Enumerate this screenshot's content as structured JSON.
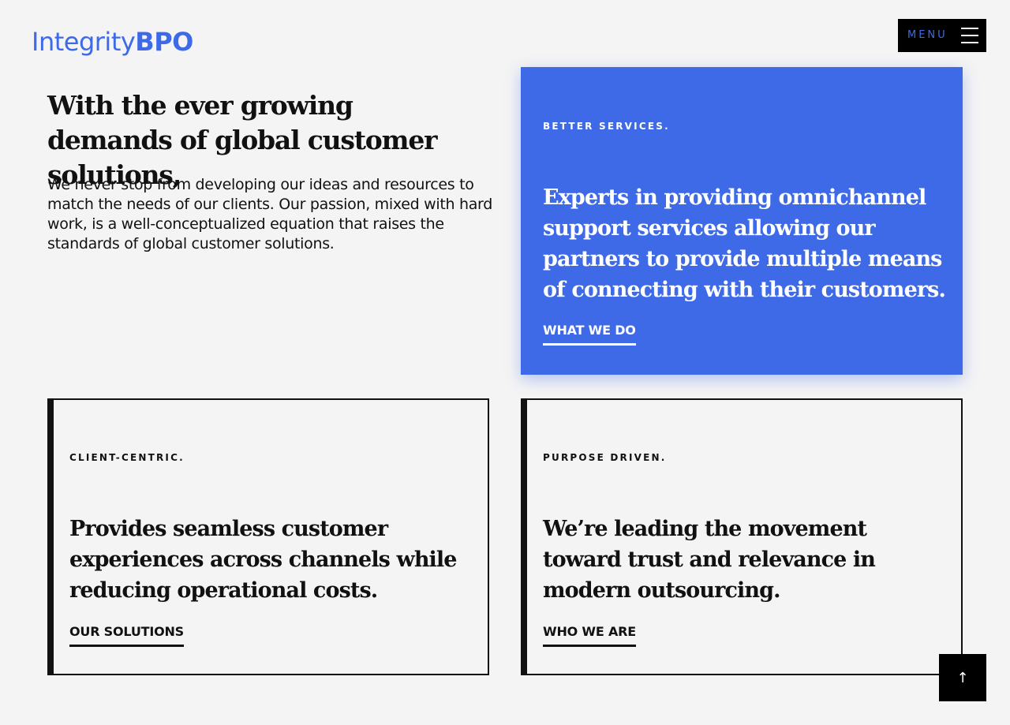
{
  "header": {
    "logo_light": "Integrity",
    "logo_bold": "BPO",
    "menu_label": "MENU",
    "brand_color": "#3e6ae8"
  },
  "intro": {
    "headline": "With the ever growing demands of global customer solutions,",
    "body": "We never stop from developing our ideas and resources to match the needs of our clients. Our passion, mixed with hard work, is a well-conceptualized equation that raises the standards of global customer solutions."
  },
  "cards": [
    {
      "eyebrow": "BETTER SERVICES.",
      "text": "Experts in providing omnichannel support services allowing our partners to provide multiple means of connecting with their customers.",
      "link": "WHAT WE DO"
    },
    {
      "eyebrow": "CLIENT-CENTRIC.",
      "text": "Provides seamless customer experiences across channels while reducing operational costs.",
      "link": "OUR SOLUTIONS"
    },
    {
      "eyebrow": "PURPOSE DRIVEN.",
      "text": "We’re leading the movement toward trust and relevance in modern outsourcing.",
      "link": "WHO WE ARE"
    }
  ],
  "back_to_top": {
    "icon": "arrow-up-icon",
    "glyph": "↑"
  }
}
